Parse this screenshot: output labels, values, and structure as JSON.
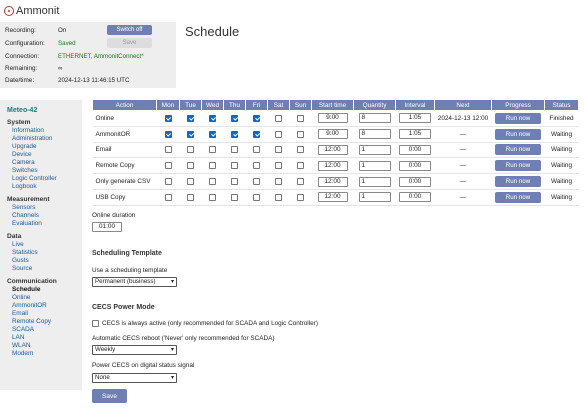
{
  "app": {
    "logo_text": "Ammonit",
    "page_title": "Schedule"
  },
  "status": {
    "recording_label": "Recording:",
    "recording_value": "On",
    "configuration_label": "Configuration:",
    "configuration_value": "Saved",
    "connection_label": "Connection:",
    "connection_value": "ETHERNET, AmmonitConnect*",
    "remaining_label": "Remaining:",
    "remaining_value": "∞",
    "datetime_label": "Date/time:",
    "datetime_value": "2024-12-13 11:46:15 UTC",
    "switch_off_label": "Switch off",
    "save_label": "Save"
  },
  "sidebar": {
    "site": "Meteo-42",
    "groups": [
      {
        "title": "System",
        "items": [
          "Information",
          "Administration",
          "Upgrade",
          "Device",
          "Camera",
          "Switches",
          "Logic Controller",
          "Logbook"
        ]
      },
      {
        "title": "Measurement",
        "items": [
          "Sensors",
          "Channels",
          "Evaluation"
        ]
      },
      {
        "title": "Data",
        "items": [
          "Live",
          "Statistics",
          "Gusts",
          "Source"
        ]
      },
      {
        "title": "Communication",
        "items": [
          "Schedule",
          "Online",
          "AmmonitOR",
          "Email",
          "Remote Copy",
          "SCADA",
          "LAN",
          "WLAN",
          "Modem"
        ]
      }
    ],
    "active_item": "Schedule"
  },
  "schedule": {
    "headers": [
      "Action",
      "Mon",
      "Tue",
      "Wed",
      "Thu",
      "Fri",
      "Sat",
      "Sun",
      "Start time",
      "Quantity",
      "Interval",
      "Next",
      "Progress",
      "Status"
    ],
    "rows": [
      {
        "action": "Online",
        "days": [
          true,
          true,
          true,
          true,
          true,
          false,
          false
        ],
        "start": "9:00",
        "quantity": "8",
        "interval": "1:05",
        "next": "2024-12-13 12:00",
        "button": "Run now",
        "status": "Finished"
      },
      {
        "action": "AmmonitOR",
        "days": [
          true,
          true,
          true,
          true,
          true,
          false,
          false
        ],
        "start": "9:00",
        "quantity": "8",
        "interval": "1:05",
        "next": "—",
        "button": "Run now",
        "status": "Waiting"
      },
      {
        "action": "Email",
        "days": [
          false,
          false,
          false,
          false,
          false,
          false,
          false
        ],
        "start": "12:00",
        "quantity": "1",
        "interval": "0:00",
        "next": "—",
        "button": "Run now",
        "status": "Waiting"
      },
      {
        "action": "Remote Copy",
        "days": [
          false,
          false,
          false,
          false,
          false,
          false,
          false
        ],
        "start": "12:00",
        "quantity": "1",
        "interval": "0:00",
        "next": "—",
        "button": "Run now",
        "status": "Waiting"
      },
      {
        "action": "Only generate CSV",
        "days": [
          false,
          false,
          false,
          false,
          false,
          false,
          false
        ],
        "start": "12:00",
        "quantity": "1",
        "interval": "0:00",
        "next": "—",
        "button": "Run now",
        "status": "Waiting"
      },
      {
        "action": "USB Copy",
        "days": [
          false,
          false,
          false,
          false,
          false,
          false,
          false
        ],
        "start": "12:00",
        "quantity": "1",
        "interval": "0:00",
        "next": "—",
        "button": "Run now",
        "status": "Waiting"
      }
    ]
  },
  "online_duration": {
    "label": "Online duration",
    "value": "01:00"
  },
  "template": {
    "heading": "Scheduling Template",
    "label": "Use a scheduling template",
    "value": "Permanent (business)"
  },
  "cecs": {
    "heading": "CECS Power Mode",
    "always_active_label": "CECS is always active (only recommended for SCADA and Logic Controller)",
    "always_active_checked": false,
    "reboot_label": "Automatic CECS reboot ('Never' only recommended for SCADA)",
    "reboot_value": "Weekly",
    "power_label": "Power CECS on digital status signal",
    "power_value": "None"
  },
  "save_button_label": "Save"
}
